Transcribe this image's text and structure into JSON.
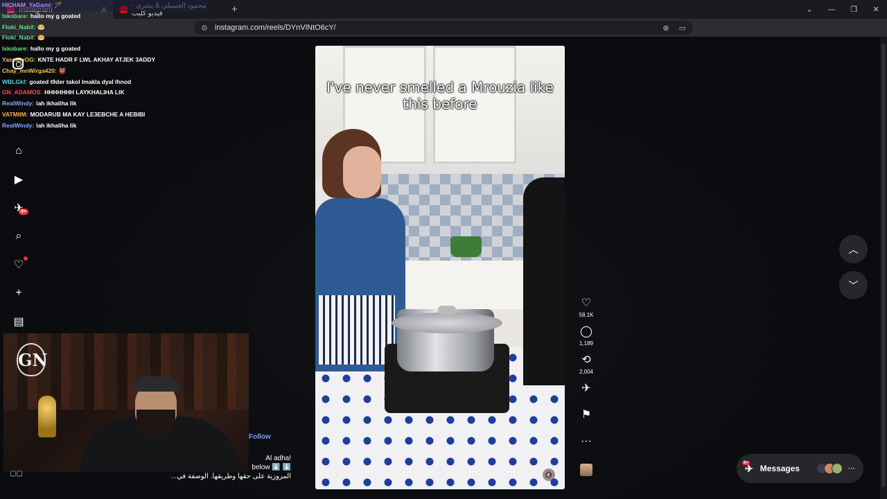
{
  "browser": {
    "tabs": [
      {
        "title": "Instagram",
        "active": true,
        "favicon_color": "#e1306c"
      },
      {
        "title": "محمود العسيلي & بشرى - فيديو كليب",
        "active": false,
        "favicon_color": "#ff0000"
      }
    ],
    "url": "instagram.com/reels/DYnVlNtO6cY/",
    "window_controls": [
      "⌄",
      "—",
      "❐",
      "✕"
    ]
  },
  "chat": [
    {
      "user": "HICHAM_YaGami:",
      "msg": "🪄",
      "color": "#b48cff"
    },
    {
      "user": "Iskobare:",
      "msg": "hallo my g goated",
      "color": "#66e08a"
    },
    {
      "user": "Floki_Nabil:",
      "msg": "🥯",
      "color": "#66e08a"
    },
    {
      "user": "Floki_Nabil:",
      "msg": "🥯",
      "color": "#66e08a"
    },
    {
      "user": "Iskobare:",
      "msg": "hallo my g goated",
      "color": "#66e08a"
    },
    {
      "user": "YassiBeOG:",
      "msg": "KNTE HADR F LWL AKHAY ATJEK 3ADDY",
      "color": "#f2c14e"
    },
    {
      "user": "Chay_mnWirga420:",
      "msg": "👹",
      "color": "#f2c14e"
    },
    {
      "user": "WBLGkf:",
      "msg": "goated t9der takol lmakla dyal lhnod",
      "color": "#4fd1e0"
    },
    {
      "user": "GN_ADAMOS:",
      "msg": "HHHHHHH LAYKHALIHA LIK",
      "color": "#ff4a4a"
    },
    {
      "user": "RealWindy:",
      "msg": "lah ikhaliha lik",
      "color": "#8aa4ff"
    },
    {
      "user": "VATMIIM:",
      "msg": "MODARUB MA KAY LE3EBCHE A HEBIBI",
      "color": "#ffb347"
    },
    {
      "user": "RealWindy:",
      "msg": "lah ikhaliha lik",
      "color": "#8aa4ff"
    }
  ],
  "sidebar": {
    "notifications_badge": "9+",
    "icons": [
      "home-icon",
      "reels-icon",
      "messages-icon",
      "search-icon",
      "heart-icon",
      "create-icon",
      "dashboard-icon"
    ]
  },
  "reel": {
    "overlay_text": "I've never smelled a Mrouzia like this before",
    "follow_label": "Follow",
    "caption_line1": "Al adha!",
    "caption_line2": "below ⬇️ ⬇️",
    "caption_line3": "المروزية على حقها وطريقها. الوصفة في...",
    "likes": "58.1K",
    "comments": "1,189",
    "reposts": "2,004"
  },
  "messages": {
    "label": "Messages",
    "badge": "9+"
  },
  "colors": {
    "accent": "#ff3040",
    "link": "#7b9df4"
  }
}
